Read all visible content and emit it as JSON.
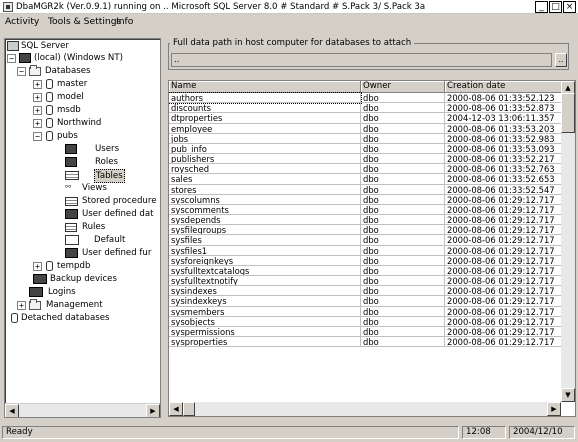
{
  "window": {
    "title": "DbaMGR2k (Ver.0.9.1) running on .. Microsoft SQL Server 8.0 # Standard # S.Pack 3/ S.Pack 3a",
    "minimize": "_",
    "maximize": "□",
    "close": "×"
  },
  "menu": [
    "Activity",
    "Tools & Settings",
    "Info"
  ],
  "tree": {
    "root": "SQL Server",
    "server": "(local) (Windows NT)",
    "databases": "Databases",
    "db_master": "master",
    "db_model": "model",
    "db_msdb": "msdb",
    "db_northwind": "Northwind",
    "db_pubs": "pubs",
    "pubs_users": "Users",
    "pubs_roles": "Roles",
    "pubs_tables": "Tables",
    "pubs_views": "Views",
    "pubs_procs": "Stored procedure",
    "pubs_udt": "User defined dat",
    "pubs_rules": "Rules",
    "pubs_default": "Default",
    "pubs_udf": "User defined fur",
    "db_tempdb": "tempdb",
    "backup": "Backup devices",
    "logins": "Logins",
    "management": "Management",
    "detached": "Detached databases",
    "expand_plus": "+",
    "expand_minus": "−"
  },
  "attach": {
    "label": "Full data path in host computer for databases to attach",
    "value": "..",
    "browse": ".."
  },
  "table": {
    "columns": [
      "Name",
      "Owner",
      "Creation date"
    ],
    "rows": [
      [
        "authors",
        "dbo",
        "2000-08-06 01:33:52.123"
      ],
      [
        "discounts",
        "dbo",
        "2000-08-06 01:33:52.873"
      ],
      [
        "dtproperties",
        "dbo",
        "2004-12-03 13:06:11.357"
      ],
      [
        "employee",
        "dbo",
        "2000-08-06 01:33:53.203"
      ],
      [
        "jobs",
        "dbo",
        "2000-08-06 01:33:52.983"
      ],
      [
        "pub_info",
        "dbo",
        "2000-08-06 01:33:53.093"
      ],
      [
        "publishers",
        "dbo",
        "2000-08-06 01:33:52.217"
      ],
      [
        "roysched",
        "dbo",
        "2000-08-06 01:33:52.763"
      ],
      [
        "sales",
        "dbo",
        "2000-08-06 01:33:52.653"
      ],
      [
        "stores",
        "dbo",
        "2000-08-06 01:33:52.547"
      ],
      [
        "syscolumns",
        "dbo",
        "2000-08-06 01:29:12.717"
      ],
      [
        "syscomments",
        "dbo",
        "2000-08-06 01:29:12.717"
      ],
      [
        "sysdepends",
        "dbo",
        "2000-08-06 01:29:12.717"
      ],
      [
        "sysfilegroups",
        "dbo",
        "2000-08-06 01:29:12.717"
      ],
      [
        "sysfiles",
        "dbo",
        "2000-08-06 01:29:12.717"
      ],
      [
        "sysfiles1",
        "dbo",
        "2000-08-06 01:29:12.717"
      ],
      [
        "sysforeignkeys",
        "dbo",
        "2000-08-06 01:29:12.717"
      ],
      [
        "sysfulltextcatalogs",
        "dbo",
        "2000-08-06 01:29:12.717"
      ],
      [
        "sysfulltextnotify",
        "dbo",
        "2000-08-06 01:29:12.717"
      ],
      [
        "sysindexes",
        "dbo",
        "2000-08-06 01:29:12.717"
      ],
      [
        "sysindexkeys",
        "dbo",
        "2000-08-06 01:29:12.717"
      ],
      [
        "sysmembers",
        "dbo",
        "2000-08-06 01:29:12.717"
      ],
      [
        "sysobjects",
        "dbo",
        "2000-08-06 01:29:12.717"
      ],
      [
        "syspermissions",
        "dbo",
        "2000-08-06 01:29:12.717"
      ],
      [
        "sysproperties",
        "dbo",
        "2000-08-06 01:29:12.717"
      ]
    ]
  },
  "scroll": {
    "left": "◀",
    "right": "▶",
    "up": "▲",
    "down": "▼"
  },
  "status": {
    "text": "Ready",
    "time": "12:08",
    "date": "2004/12/10"
  }
}
